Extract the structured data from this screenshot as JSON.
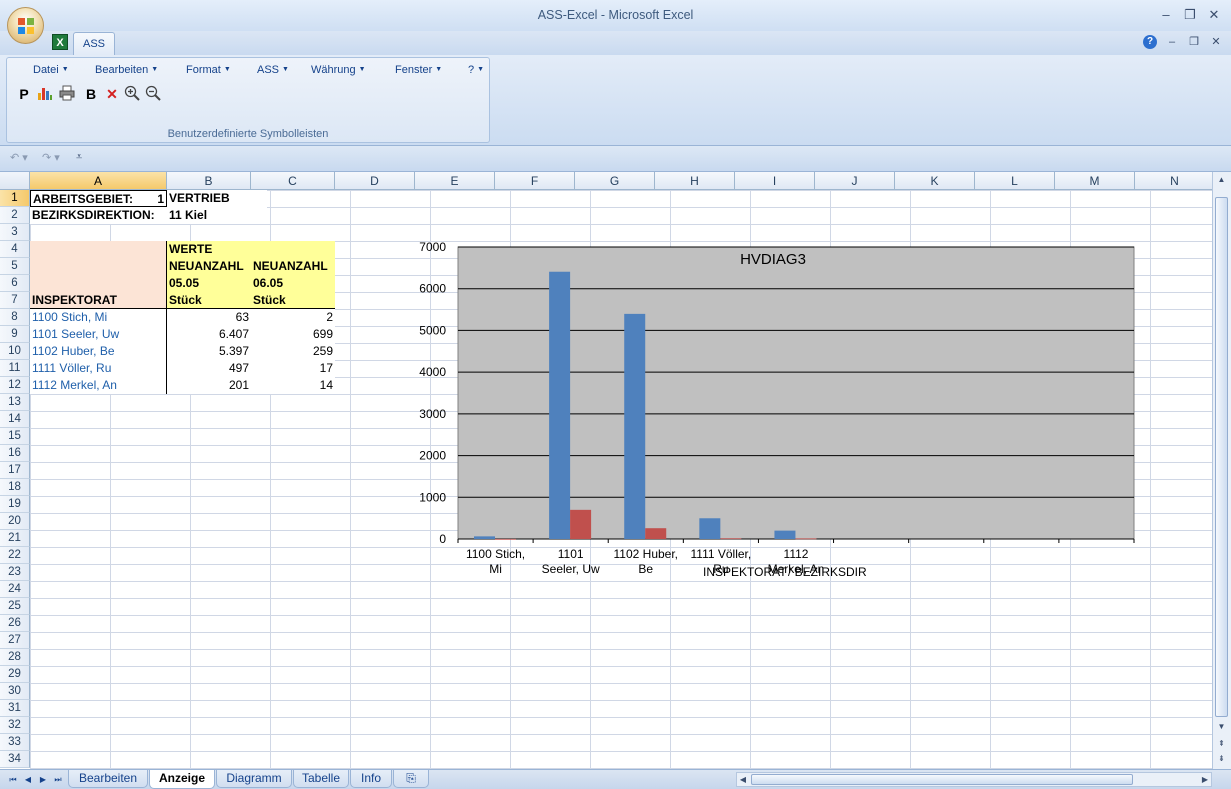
{
  "window": {
    "title": "ASS-Excel - Microsoft Excel"
  },
  "ribbon": {
    "tab": "ASS",
    "menus": [
      "Datei",
      "Bearbeiten",
      "Format",
      "ASS",
      "Währung",
      "Fenster",
      "?"
    ],
    "toolbar_text": {
      "p": "P",
      "b": "B"
    },
    "group_label": "Benutzerdefinierte Symbolleisten"
  },
  "columns": [
    "A",
    "B",
    "C",
    "D",
    "E",
    "F",
    "G",
    "H",
    "I",
    "J",
    "K",
    "L",
    "M",
    "N"
  ],
  "rows": [
    "1",
    "2",
    "3",
    "4",
    "5",
    "6",
    "7",
    "8",
    "9",
    "10",
    "11",
    "12",
    "13",
    "14",
    "15",
    "16",
    "17",
    "18",
    "19",
    "20",
    "21",
    "22",
    "23",
    "24",
    "25",
    "26",
    "27",
    "28",
    "29",
    "30",
    "31",
    "32",
    "33",
    "34"
  ],
  "sheet": {
    "a1": "ARBEITSGEBIET:",
    "a1_tail": "1",
    "b1": "VERTRIEB",
    "a2": "BEZIRKSDIREKTION:",
    "b2": "11 Kiel",
    "b4": "WERTE",
    "b5": "NEUANZAHL",
    "c5": "NEUANZAHL",
    "b6": "05.05",
    "c6": "06.05",
    "b7": "Stück",
    "c7": "Stück",
    "a7": "INSPEKTORAT",
    "data_rows": [
      {
        "name": "1100 Stich, Mi",
        "b": "63",
        "c": "2"
      },
      {
        "name": "1101 Seeler, Uw",
        "b": "6.407",
        "c": "699"
      },
      {
        "name": "1102 Huber, Be",
        "b": "5.397",
        "c": "259"
      },
      {
        "name": "1111 Völler, Ru",
        "b": "497",
        "c": "17"
      },
      {
        "name": "1112 Merkel, An",
        "b": "201",
        "c": "14"
      }
    ]
  },
  "chart_data": {
    "type": "bar",
    "title": "HVDIAG3",
    "categories": [
      "1100 Stich, Mi",
      "1101 Seeler, Uw",
      "1102 Huber, Be",
      "1111 Völler, Ru",
      "1112 Merkel, An",
      "",
      "",
      "",
      ""
    ],
    "category_label_lines": [
      [
        "1100 Stich,",
        "Mi"
      ],
      [
        "1101",
        "Seeler, Uw"
      ],
      [
        "1102 Huber,",
        "Be"
      ],
      [
        "1111 Völler,",
        "Ru"
      ],
      [
        "1112",
        "Merkel, An"
      ]
    ],
    "series": [
      {
        "values": [
          63,
          6407,
          5397,
          497,
          201
        ],
        "color": "#4f81bd"
      },
      {
        "values": [
          2,
          699,
          259,
          17,
          14
        ],
        "color": "#c0504d"
      }
    ],
    "ylim": [
      0,
      7000
    ],
    "yticks": [
      "0",
      "1000",
      "2000",
      "3000",
      "4000",
      "5000",
      "6000",
      "7000"
    ],
    "overlay_labels": [
      "INSPEKTORAT",
      "/ BEZIRKSDIR"
    ],
    "plot_bg": "#c0c0c0",
    "grid": true
  },
  "sheet_tabs": [
    "Bearbeiten",
    "Anzeige",
    "Diagramm",
    "Tabelle",
    "Info"
  ],
  "active_sheet": "Anzeige"
}
